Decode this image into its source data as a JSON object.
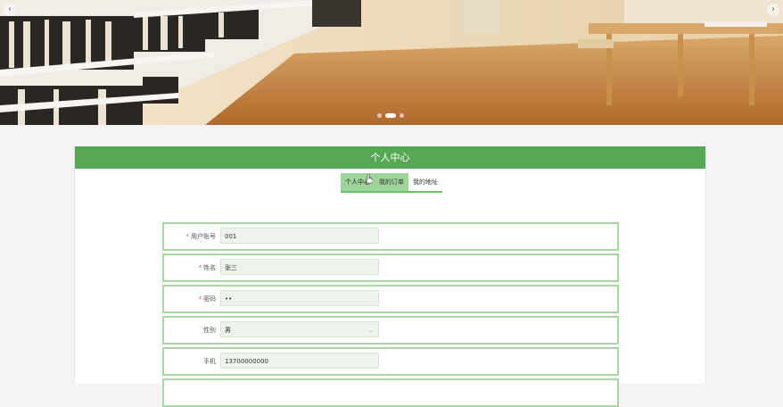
{
  "banner": {
    "prev_icon": "chevron-left-icon",
    "next_icon": "chevron-right-icon",
    "prev_glyph": "‹",
    "next_glyph": "›",
    "slide_count": 3,
    "active_slide": 2
  },
  "panel": {
    "title": "个人中心",
    "accent_color": "#57a854"
  },
  "tabs": [
    {
      "label": "个人中心",
      "active": true
    },
    {
      "label": "我的订单",
      "active": false
    },
    {
      "label": "我的地址",
      "active": false
    }
  ],
  "form": {
    "fields": [
      {
        "label": "用户账号",
        "required": true,
        "value": "001",
        "type": "text"
      },
      {
        "label": "姓名",
        "required": true,
        "value": "张三",
        "type": "text"
      },
      {
        "label": "密码",
        "required": true,
        "value": "••",
        "type": "password"
      },
      {
        "label": "性别",
        "required": false,
        "value": "男",
        "type": "select"
      },
      {
        "label": "手机",
        "required": false,
        "value": "13700000000",
        "type": "text"
      }
    ],
    "select_arrow": "⌄"
  }
}
